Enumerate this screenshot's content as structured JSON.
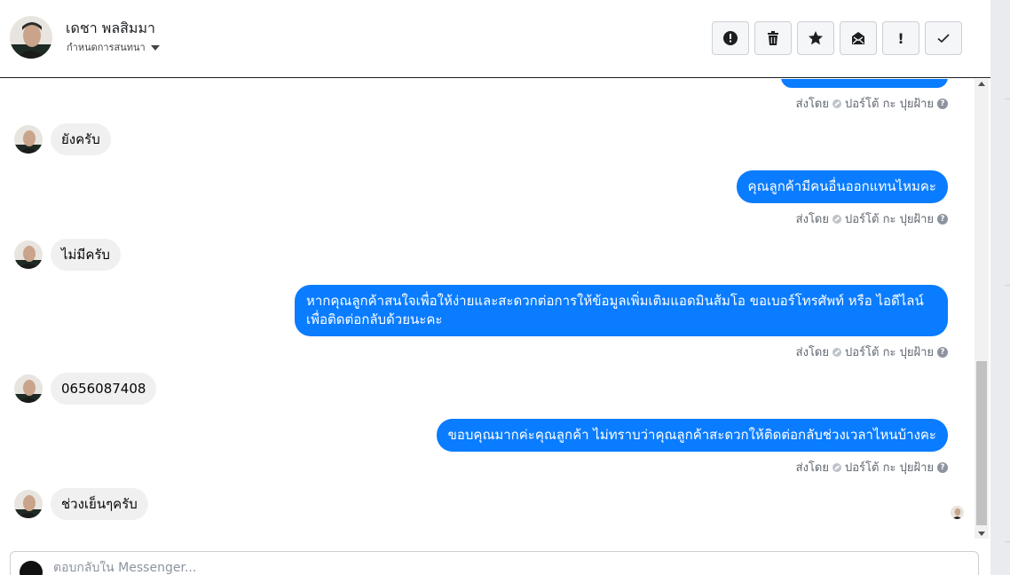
{
  "header": {
    "contact_name": "เดชา พลสิมมา",
    "assign_label": "กำหนดการสนทนา",
    "toolbar": [
      {
        "name": "alert-circle-icon",
        "glyph": ""
      },
      {
        "name": "trash-icon",
        "glyph": ""
      },
      {
        "name": "star-icon",
        "glyph": ""
      },
      {
        "name": "mail-icon",
        "glyph": ""
      },
      {
        "name": "exclamation-icon",
        "glyph": "!"
      },
      {
        "name": "check-icon",
        "glyph": ""
      }
    ]
  },
  "messages": [
    {
      "dir": "out",
      "text": "",
      "sent_by": "ส่งโดย",
      "sender": "ปอร์โต้ กะ ปุยฝ้าย"
    },
    {
      "dir": "in",
      "text": "ยังครับ"
    },
    {
      "dir": "out",
      "text": "คุณลูกค้ามีคนอื่นออกแทนไหมคะ",
      "sent_by": "ส่งโดย",
      "sender": "ปอร์โต้ กะ ปุยฝ้าย"
    },
    {
      "dir": "in",
      "text": "ไม่มีครับ"
    },
    {
      "dir": "out",
      "text": "หากคุณลูกค้าสนใจเพื่อให้ง่ายและสะดวกต่อการให้ข้อมูลเพิ่มเติมแอดมินส้มโอ ขอเบอร์โทรศัพท์ หรือ ไอดีไลน์ เพื่อติดต่อกลับด้วยนะคะ",
      "sent_by": "ส่งโดย",
      "sender": "ปอร์โต้ กะ ปุยฝ้าย"
    },
    {
      "dir": "in",
      "text": "0656087408"
    },
    {
      "dir": "out",
      "text": "ขอบคุณมากค่ะคุณลูกค้า ไม่ทราบว่าคุณลูกค้าสะดวกให้ติดต่อกลับช่วงเวลาไหนบ้างคะ",
      "sent_by": "ส่งโดย",
      "sender": "ปอร์โต้ กะ ปุยฝ้าย"
    },
    {
      "dir": "in",
      "text": "ช่วงเย็นๆครับ"
    }
  ],
  "composer": {
    "placeholder": "ตอบกลับใน Messenger..."
  }
}
